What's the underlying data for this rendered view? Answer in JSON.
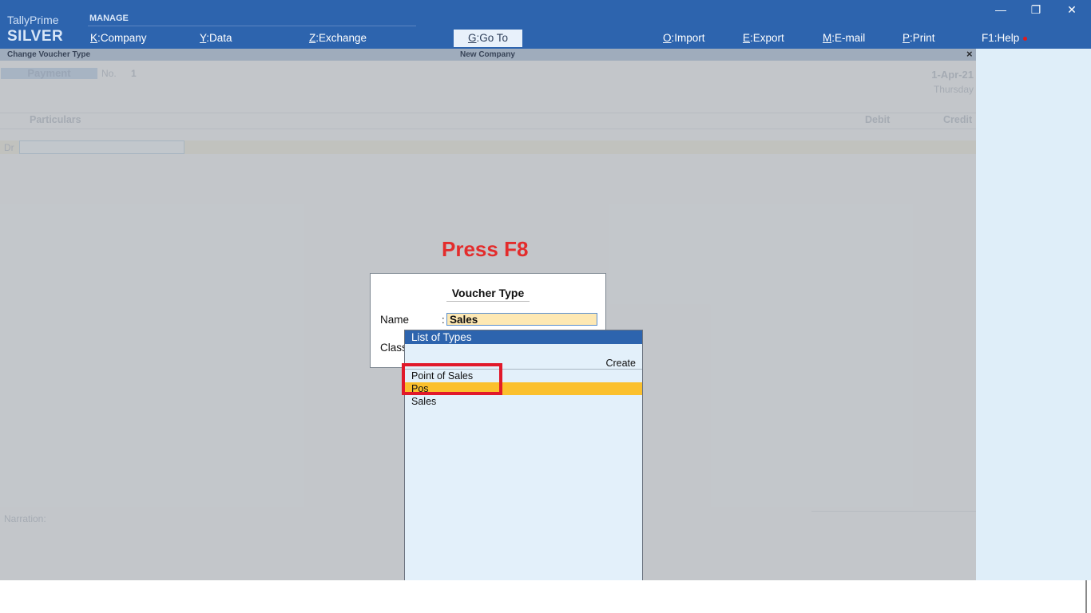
{
  "app": {
    "name": "TallyPrime",
    "edition": "SILVER"
  },
  "topbar": {
    "manage_label": "MANAGE",
    "menus": [
      {
        "key": "K",
        "label": "Company"
      },
      {
        "key": "Y",
        "label": "Data"
      },
      {
        "key": "Z",
        "label": "Exchange"
      }
    ],
    "goto": {
      "key": "G",
      "label": "Go To"
    },
    "right_menus": [
      {
        "key": "O",
        "label": "Import"
      },
      {
        "key": "E",
        "label": "Export"
      },
      {
        "key": "M",
        "label": "E-mail"
      },
      {
        "key": "P",
        "label": "Print"
      },
      {
        "key": "F1",
        "label": "Help"
      }
    ],
    "window_controls": {
      "minimize": "—",
      "restore": "❐",
      "close": "✕"
    }
  },
  "subbar": {
    "left": "Change Voucher Type",
    "center": "New Company",
    "close": "×"
  },
  "voucher": {
    "type": "Payment",
    "no_label": "No.",
    "no_value": "1",
    "date": "1-Apr-21",
    "day": "Thursday",
    "col_particulars": "Particulars",
    "col_debit": "Debit",
    "col_credit": "Credit",
    "dr_label": "Dr",
    "narration_label": "Narration:"
  },
  "annotation": {
    "press_text": "Press F8",
    "color": "#e32c2c"
  },
  "dialog": {
    "title": "Voucher Type",
    "name_label": "Name",
    "colon": ":",
    "name_value": "Sales",
    "class_label": "Class"
  },
  "list": {
    "title": "List of Types",
    "create_label": "Create",
    "items": [
      "Point of Sales",
      "Pos",
      "Sales"
    ],
    "selected": "Pos"
  },
  "colors": {
    "brand_blue": "#2d64ae",
    "selection_yellow": "#fbc02d",
    "highlight_red": "#e1192a"
  }
}
